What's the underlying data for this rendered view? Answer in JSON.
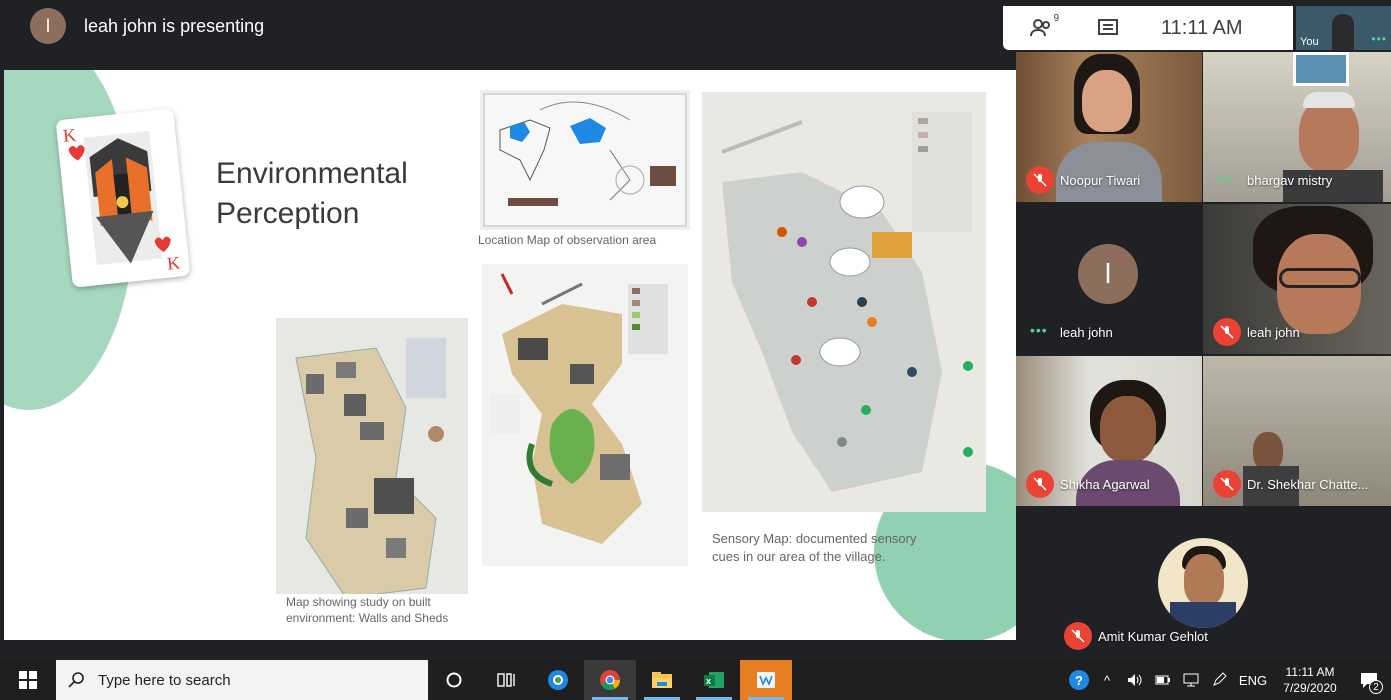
{
  "meet": {
    "presenter_initial": "l",
    "presenting_text": "leah john is presenting",
    "people_count": "9",
    "clock": "11:11 AM",
    "you_label": "You"
  },
  "slide": {
    "title_line1": "Environmental",
    "title_line2": "Perception",
    "captions": {
      "location_map": "Location Map of observation area",
      "built_env_line1": "Map showing study on built",
      "built_env_line2": "environment: Walls and Sheds",
      "sensory_line1": "Sensory Map: documented sensory",
      "sensory_line2": "cues in our area of the village."
    }
  },
  "participants": [
    {
      "name": "Noopur Tiwari",
      "muted": true
    },
    {
      "name": "bhargav mistry",
      "muted": false
    },
    {
      "name": "leah john",
      "muted": false,
      "initial": "l"
    },
    {
      "name": "leah john",
      "muted": true
    },
    {
      "name": "Shikha Agarwal",
      "muted": true
    },
    {
      "name": "Dr. Shekhar Chatte...",
      "muted": true
    },
    {
      "name": "Amit Kumar Gehlot",
      "muted": true
    }
  ],
  "taskbar": {
    "search_placeholder": "Type here to search",
    "language": "ENG",
    "time": "11:11 AM",
    "date": "7/29/2020",
    "notification_count": "2"
  },
  "colors": {
    "meet_bg": "#202124",
    "mic_off": "#ea4335",
    "speaking_dots": "#5cd08d",
    "slide_green": "#7ec8a2"
  }
}
